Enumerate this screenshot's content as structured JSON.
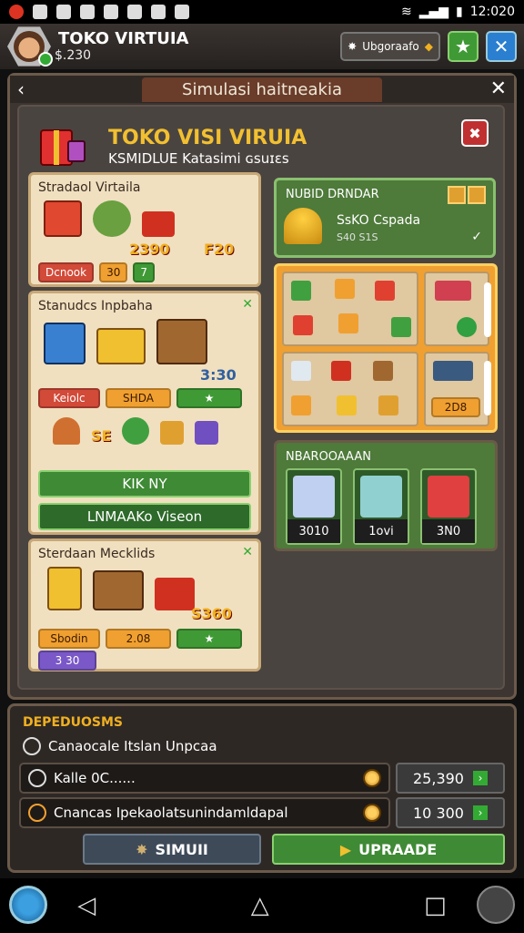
{
  "status_bar": {
    "time": "12:020"
  },
  "top_bar": {
    "shop_name": "TOKO VIRTUIA",
    "money": "$.230",
    "pill_label": "Ubgoraafo",
    "colors": {
      "green": "#3f9a35",
      "blue": "#2a7fd0"
    }
  },
  "dialog": {
    "title": "Simulasi haitneakia",
    "header_title": "TOKO VISI VIRUIA",
    "header_sub": "KSMIDLUE Katasimi ɢsuɪɛs"
  },
  "cards": [
    {
      "title": "Stradaol Virtaila",
      "price": "2390",
      "price2": "F20",
      "tags": [
        "Dcnook",
        "30",
        "7"
      ]
    },
    {
      "title": "Stanudcs Inpbaha",
      "price": "3:30",
      "tags": [
        "Keiolc",
        "SHDA",
        "★"
      ],
      "price2": "SE",
      "buttons": [
        "KIK NY",
        "LNMAAKo Viseon"
      ]
    },
    {
      "title": "Sterdaan Mecklids",
      "price": "S360",
      "tags": [
        "Sbodin",
        "2.08",
        "★"
      ],
      "tag_purple": "3 30"
    }
  ],
  "green_panel": {
    "title": "NUBID DRNDAR",
    "item_name": "SsKO Cspada",
    "item_value": "S40 S1S"
  },
  "shelf": {
    "price": "2D8"
  },
  "products": {
    "title": "NBAROOAAAN",
    "items": [
      {
        "label": "3010"
      },
      {
        "label": "1ovi"
      },
      {
        "label": "3N0"
      }
    ]
  },
  "bottom": {
    "title": "DEPEDUOSMS",
    "sub": "Canaocale Itslan Unpcaa",
    "rows": [
      {
        "label": "Kalle 0C......",
        "value": "25,390"
      },
      {
        "label": "Cnancas Ipekaolatsunindamldapal",
        "value": "10 300"
      }
    ],
    "btn_simulate": "SIMUII",
    "btn_upgrade": "UPRAADE"
  }
}
